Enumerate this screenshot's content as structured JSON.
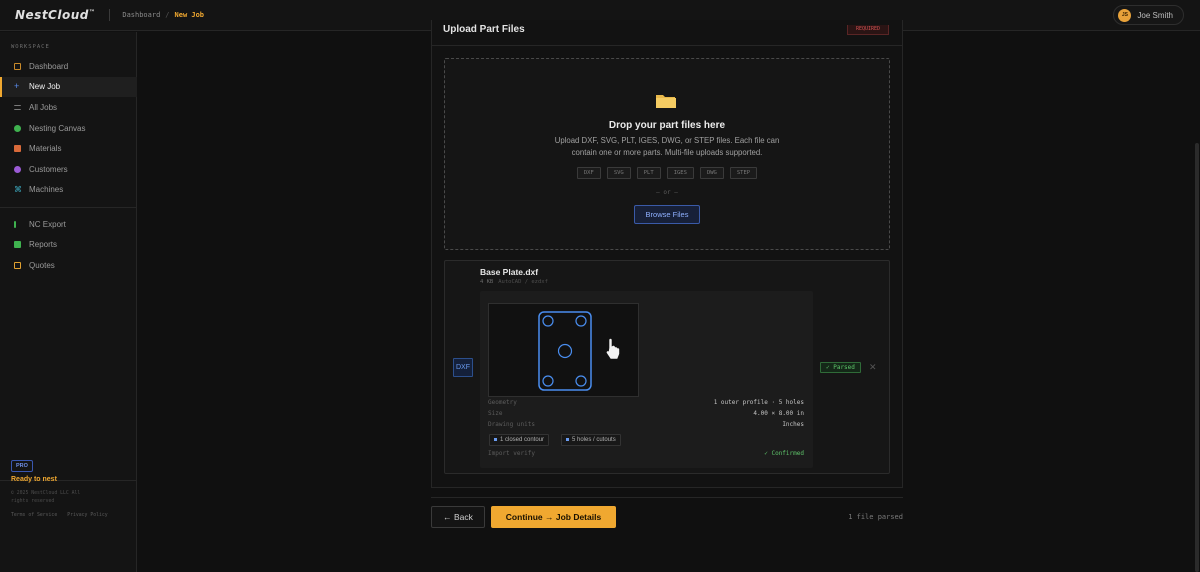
{
  "app": {
    "logo": "NestCloud",
    "logo_mark": "™"
  },
  "breadcrumb": {
    "parent": "Dashboard",
    "separator": "/",
    "current": "New Job"
  },
  "user": {
    "initials": "JS",
    "name": "Joe Smith"
  },
  "sidebar": {
    "section_label": "WORKSPACE",
    "items": [
      {
        "label": "Dashboard",
        "icon": "grid-icon",
        "color": "#c98a2a",
        "active": false
      },
      {
        "label": "New Job",
        "icon": "plus-icon",
        "color": "#5b8def",
        "active": true
      },
      {
        "label": "All Jobs",
        "icon": "list-icon",
        "color": "#7a7a7a",
        "active": false
      },
      {
        "label": "Nesting Canvas",
        "icon": "canvas-icon",
        "color": "#3fb24f",
        "active": false
      },
      {
        "label": "Materials",
        "icon": "materials-icon",
        "color": "#d96a3a",
        "active": false
      },
      {
        "label": "Customers",
        "icon": "customers-icon",
        "color": "#9b5bd6",
        "active": false
      },
      {
        "label": "Machines",
        "icon": "machine-icon",
        "color": "#3aa3b8",
        "active": false
      }
    ],
    "secondary_items": [
      {
        "label": "NC Export",
        "icon": "export-icon",
        "color": "#3fb24f"
      },
      {
        "label": "Reports",
        "icon": "reports-icon",
        "color": "#3fb24f"
      },
      {
        "label": "Quotes",
        "icon": "quotes-icon",
        "color": "#e0a030"
      }
    ],
    "plan_badge": "PRO",
    "plan_status": "Ready to nest",
    "copyright": "© 2025 NestCloud LLC All rights reserved",
    "legal_links": [
      "Terms of Service",
      "Privacy Policy"
    ]
  },
  "upload": {
    "title": "Upload Part Files",
    "required_badge": "REQUIRED",
    "drop_icon": "folder-icon",
    "drop_title": "Drop your part files here",
    "drop_description": "Upload DXF, SVG, PLT, IGES, DWG, or STEP files. Each file can contain one or more parts. Multi-file uploads supported.",
    "formats": [
      "DXF",
      "SVG",
      "PLT",
      "IGES",
      "DWG",
      "STEP"
    ],
    "or_text": "— or —",
    "browse_label": "Browse Files"
  },
  "file": {
    "type_badge": "DXF",
    "name": "Base Plate.dxf",
    "size": "4 KB",
    "source": "AutoCAD / ezdxf",
    "status": "✓ Parsed",
    "remove_icon": "close-icon",
    "details": [
      {
        "key": "Geometry",
        "value": "1 outer profile · 5 holes"
      },
      {
        "key": "Size",
        "value": "4.00 × 8.00 in"
      },
      {
        "key": "Drawing units",
        "value": "Inches"
      }
    ],
    "tags": [
      "1 closed contour",
      "5 holes / cutouts"
    ],
    "verify": {
      "key": "Import verify",
      "value": "✓ Confirmed"
    }
  },
  "footer": {
    "back_label": "← Back",
    "continue_label": "Continue → Job Details",
    "status": "1 file parsed"
  }
}
